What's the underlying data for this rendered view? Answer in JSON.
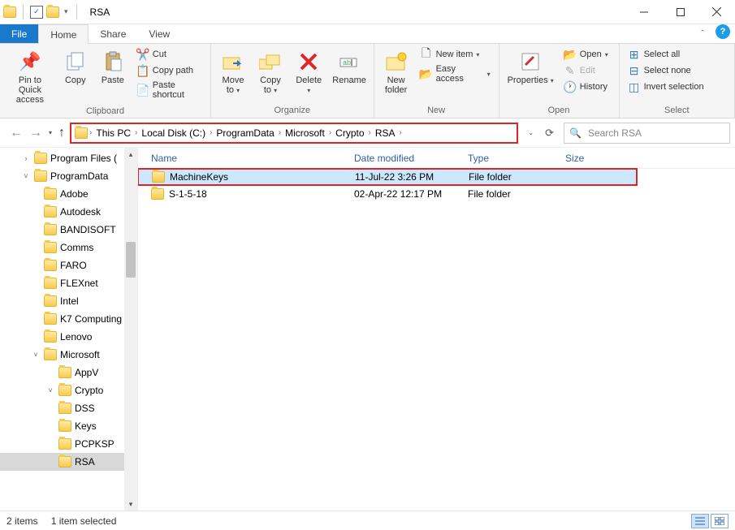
{
  "window": {
    "title": "RSA"
  },
  "tabs": {
    "file": "File",
    "home": "Home",
    "share": "Share",
    "view": "View"
  },
  "ribbon": {
    "clipboard": {
      "label": "Clipboard",
      "pin": "Pin to Quick\naccess",
      "copy": "Copy",
      "paste": "Paste",
      "cut": "Cut",
      "copy_path": "Copy path",
      "paste_shortcut": "Paste shortcut"
    },
    "organize": {
      "label": "Organize",
      "move_to": "Move\nto",
      "copy_to": "Copy\nto",
      "delete": "Delete",
      "rename": "Rename"
    },
    "new": {
      "label": "New",
      "new_folder": "New\nfolder",
      "new_item": "New item",
      "easy_access": "Easy access"
    },
    "open": {
      "label": "Open",
      "properties": "Properties",
      "open": "Open",
      "edit": "Edit",
      "history": "History"
    },
    "select": {
      "label": "Select",
      "select_all": "Select all",
      "select_none": "Select none",
      "invert": "Invert selection"
    }
  },
  "breadcrumbs": [
    "This PC",
    "Local Disk (C:)",
    "ProgramData",
    "Microsoft",
    "Crypto",
    "RSA"
  ],
  "search": {
    "placeholder": "Search RSA"
  },
  "columns": {
    "name": "Name",
    "date": "Date modified",
    "type": "Type",
    "size": "Size"
  },
  "rows": [
    {
      "name": "MachineKeys",
      "date": "11-Jul-22 3:26 PM",
      "type": "File folder",
      "size": ""
    },
    {
      "name": "S-1-5-18",
      "date": "02-Apr-22 12:17 PM",
      "type": "File folder",
      "size": ""
    }
  ],
  "tree": [
    {
      "label": "Program Files (",
      "depth": 0,
      "disclosure": ">"
    },
    {
      "label": "ProgramData",
      "depth": 0,
      "disclosure": "v"
    },
    {
      "label": "Adobe",
      "depth": 1,
      "disclosure": ""
    },
    {
      "label": "Autodesk",
      "depth": 1,
      "disclosure": ""
    },
    {
      "label": "BANDISOFT",
      "depth": 1,
      "disclosure": ""
    },
    {
      "label": "Comms",
      "depth": 1,
      "disclosure": ""
    },
    {
      "label": "FARO",
      "depth": 1,
      "disclosure": ""
    },
    {
      "label": "FLEXnet",
      "depth": 1,
      "disclosure": ""
    },
    {
      "label": "Intel",
      "depth": 1,
      "disclosure": ""
    },
    {
      "label": "K7 Computing",
      "depth": 1,
      "disclosure": ""
    },
    {
      "label": "Lenovo",
      "depth": 1,
      "disclosure": ""
    },
    {
      "label": "Microsoft",
      "depth": 1,
      "disclosure": "v"
    },
    {
      "label": "AppV",
      "depth": 2,
      "disclosure": ""
    },
    {
      "label": "Crypto",
      "depth": 2,
      "disclosure": "v"
    },
    {
      "label": "DSS",
      "depth": 2,
      "disclosure": ""
    },
    {
      "label": "Keys",
      "depth": 2,
      "disclosure": ""
    },
    {
      "label": "PCPKSP",
      "depth": 2,
      "disclosure": ""
    },
    {
      "label": "RSA",
      "depth": 2,
      "disclosure": "",
      "selected": true
    }
  ],
  "status": {
    "items": "2 items",
    "selected": "1 item selected"
  }
}
